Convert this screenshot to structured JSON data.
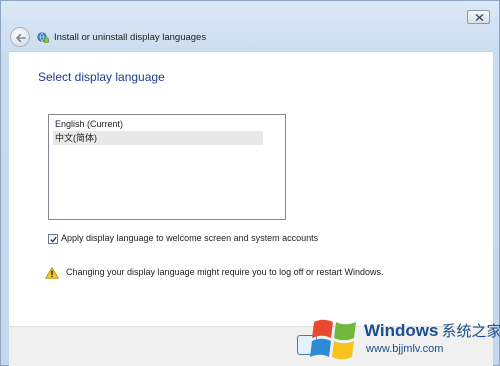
{
  "window": {
    "title": "Install or uninstall display languages",
    "close_icon": "close-icon",
    "back_icon": "back-arrow-icon"
  },
  "main": {
    "heading": "Select display language",
    "languages": [
      {
        "label": "English (Current)",
        "selected": false
      },
      {
        "label": "中文(简体)",
        "selected": true
      }
    ],
    "apply_checkbox": {
      "label": "Apply display language to welcome screen and system accounts",
      "checked": true
    },
    "warning": {
      "icon": "warning-icon",
      "text": "Changing your display language might require you to log off or restart Windows."
    }
  },
  "watermark": {
    "brand": "Windows",
    "brand_cn": "系统之家",
    "url": "www.bjjmlv.com"
  },
  "colors": {
    "heading": "#1e3d8f",
    "selection": "#e8e8e8",
    "window_frame": "#c9dbee",
    "watermark": "#1b4f8d"
  }
}
